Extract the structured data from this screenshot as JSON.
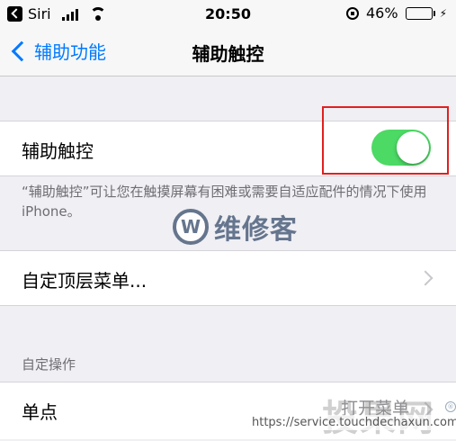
{
  "status_bar": {
    "carrier": "Siri",
    "time": "20:50",
    "battery_percent": "46%",
    "battery_level": 0.46,
    "battery_color": "#4cd964"
  },
  "nav": {
    "back_label": "辅助功能",
    "title": "辅助触控"
  },
  "assistive_touch": {
    "label": "辅助触控",
    "enabled": true,
    "toggle_color": "#4cd964",
    "footnote": "“辅助触控”可让您在触摸屏幕有困难或需要自适应配件的情况下使用 iPhone。"
  },
  "top_level_menu": {
    "label": "自定顶层菜单..."
  },
  "custom_actions": {
    "header": "自定操作",
    "single_tap_label": "单点",
    "single_tap_value": "打开菜单"
  },
  "watermark": {
    "logo_letter": "W",
    "brand": "维修客",
    "url": "https://service.touchdechaxun.com",
    "big_text": "投果网"
  },
  "colors": {
    "accent": "#007aff",
    "highlight_box": "#e02020"
  }
}
